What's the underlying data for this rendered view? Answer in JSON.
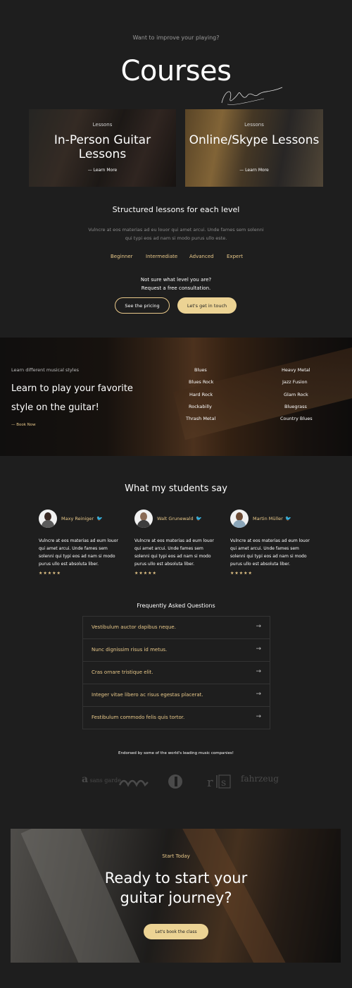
{
  "hero": {
    "eyebrow": "Want to improve your playing?",
    "title": "Courses"
  },
  "cards": [
    {
      "small": "Lessons",
      "title": "In-Person Guitar Lessons",
      "link": "— Learn More"
    },
    {
      "small": "Lessons",
      "title": "Online/Skype Lessons",
      "link": "— Learn More"
    }
  ],
  "levels_section": {
    "title": "Structured lessons for each level",
    "description": "Vulncre at eos materias ad eu louor qui amet arcui. Unde fames sem solenni qui typi eos ad nam si modo purus ullo este.",
    "levels": [
      "Beginner",
      "Intermediate",
      "Advanced",
      "Expert"
    ],
    "not_sure_line1": "Not sure what level you are?",
    "not_sure_line2": "Request a free consultation.",
    "btn_pricing": "See the pricing",
    "btn_touch": "Let's get in touch"
  },
  "styles_banner": {
    "eyebrow": "Learn different musical styles",
    "title": "Learn to play your favorite style on the guitar!",
    "link": "— Book Now",
    "left_styles": [
      "Blues",
      "Blues Rock",
      "Hard Rock",
      "Rockabilly",
      "Thrash Metal"
    ],
    "right_styles": [
      "Heavy Metal",
      "Jazz Fusion",
      "Glam Rock",
      "Bluegrass",
      "Country Blues"
    ]
  },
  "testimonials": {
    "title": "What my students say",
    "items": [
      {
        "name": "Maxy Reiniger",
        "quote": "Vulncre at eos materias ad eum louor qui amet arcui. Unde fames sem solenni qui typi eos ad nam si modo purus ullo est absoluta liber.",
        "stars": "★★★★★"
      },
      {
        "name": "Walt Grunewald",
        "quote": "Vulncre at eos materias ad eum louor qui amet arcui. Unde fames sem solenni qui typi eos ad nam si modo purus ullo est absoluta liber.",
        "stars": "★★★★★"
      },
      {
        "name": "Martin Müller",
        "quote": "Vulncre at eos materias ad eum louor qui amet arcui. Unde fames sem solenni qui typi eos ad nam si modo purus ullo est absoluta liber.",
        "stars": "★★★★★"
      }
    ]
  },
  "faq": {
    "title": "Frequently Asked Questions",
    "items": [
      "Vestibulum auctor dapibus neque.",
      "Nunc dignissim risus id metus.",
      "Cras ornare tristique elit.",
      "Integer vitae libero ac risus egestas placerat.",
      "Festibulum commodo felis quis tortor."
    ],
    "arrow": "→"
  },
  "endorsed": {
    "text": "Endorsed by some of the world's leading music companies!",
    "logos": [
      "sans garde",
      "fahrzeug"
    ]
  },
  "cta": {
    "eyebrow": "Start Today",
    "title_line1": "Ready to start your",
    "title_line2": "guitar journey?",
    "button": "Let's book the class"
  },
  "colors": {
    "background": "#1e1e1e",
    "accent": "#e9c98a",
    "button_fill": "#ecd394"
  }
}
